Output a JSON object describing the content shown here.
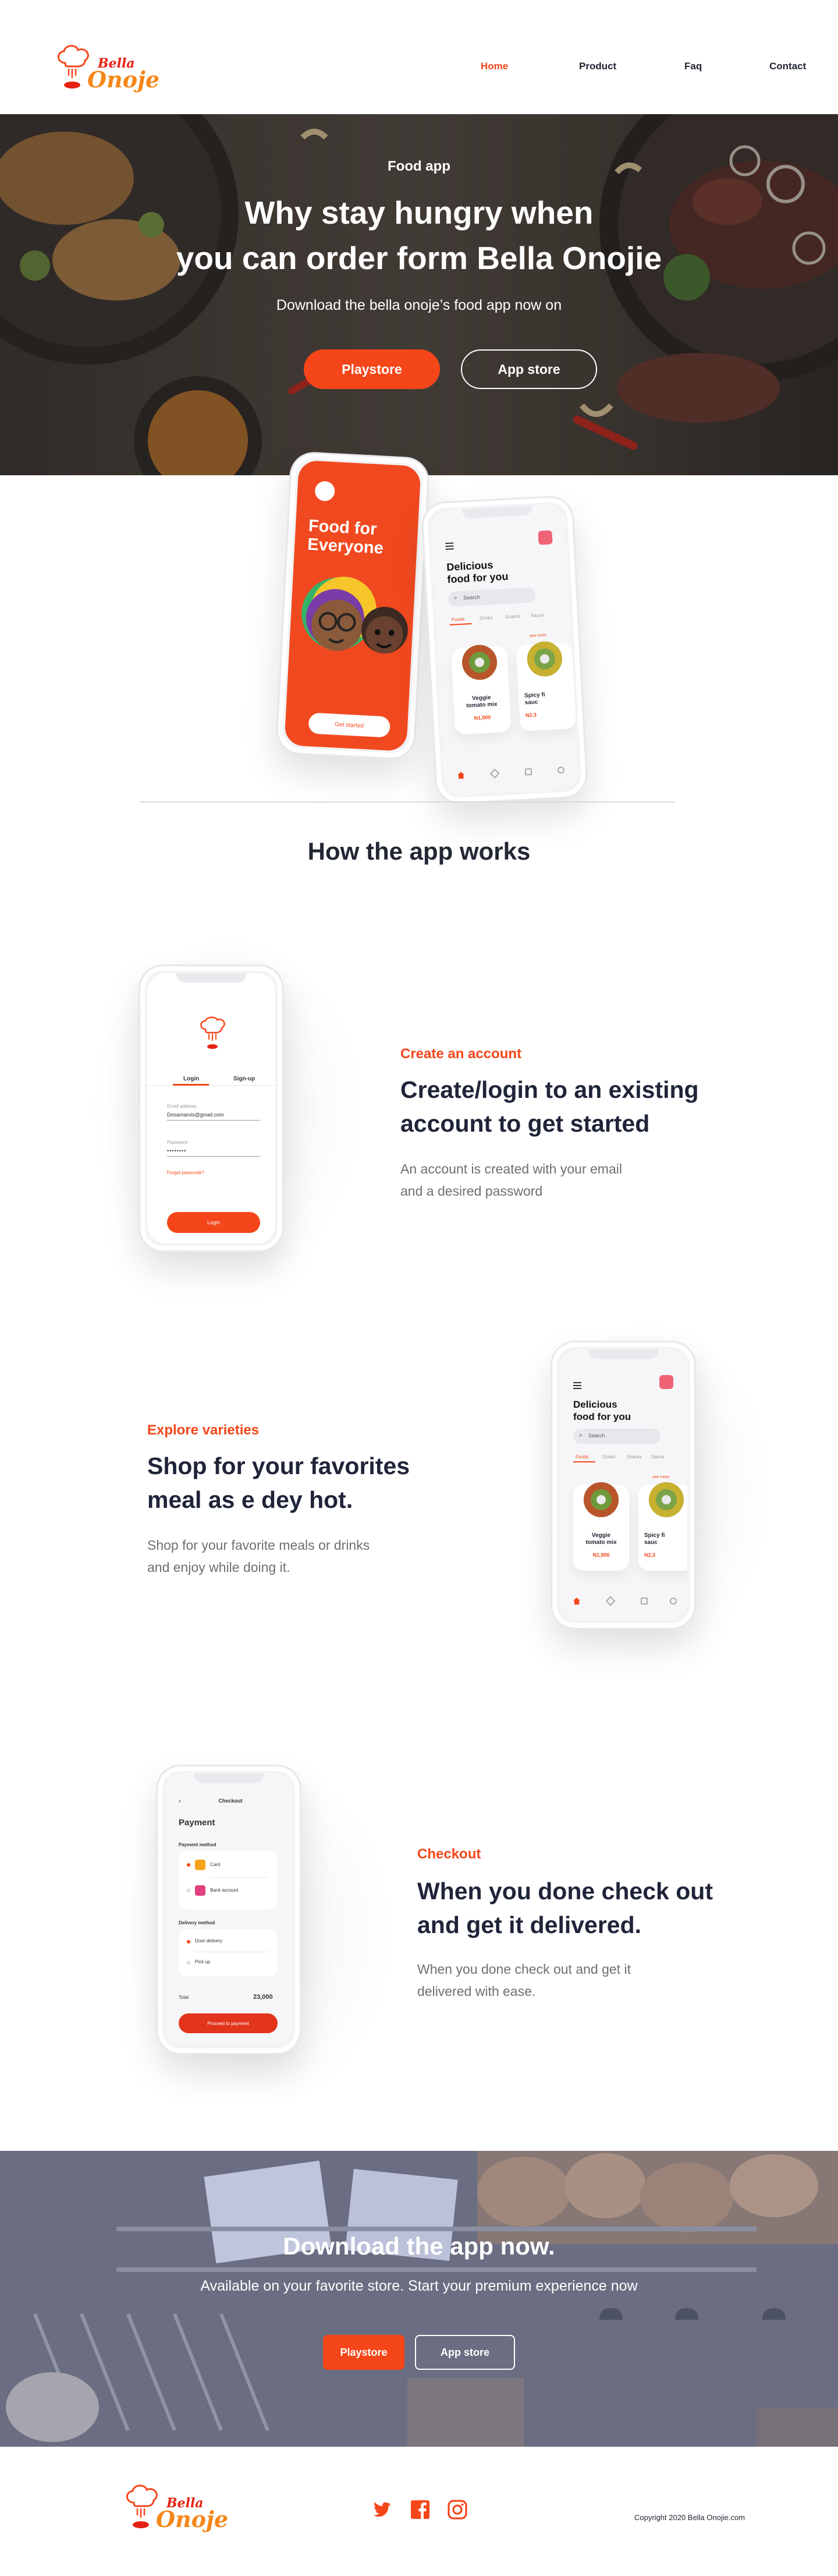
{
  "brand": {
    "name_top": "Bella",
    "name_bottom": "Onoje",
    "accent": "#f5461a",
    "dark": "#1f2439"
  },
  "nav": {
    "items": [
      "Home",
      "Product",
      "Faq",
      "Contact"
    ],
    "active": "Home"
  },
  "hero": {
    "kicker": "Food app",
    "title_line1": "Why stay hungry when",
    "title_line2": "you can order form Bella Onojie",
    "subtitle": "Download the bella onoje’s food app now on",
    "btn_primary": "Playstore",
    "btn_secondary": "App store"
  },
  "hero_phones": {
    "splash_title_line1": "Food for",
    "splash_title_line2": "Everyone",
    "splash_button": "Get started",
    "menu_title_line1": "Delicious",
    "menu_title_line2": "food for you",
    "search_placeholder": "Search",
    "tabs": [
      "Foods",
      "Drinks",
      "Snacks",
      "Sauce"
    ],
    "see_more": "see more",
    "card1_name_line1": "Veggie",
    "card1_name_line2": "tomato mix",
    "card1_price": "N1,900",
    "card2_name_line1": "Spicy fi",
    "card2_name_line2": "sauc",
    "card2_price": "N2,3"
  },
  "how": {
    "title": "How the app works"
  },
  "step1": {
    "kicker": "Create an account",
    "heading_line1": "Create/login to an existing",
    "heading_line2": "account to get started",
    "para_line1": "An account is created with your email",
    "para_line2": "and a desired password",
    "phone": {
      "tab_login": "Login",
      "tab_signup": "Sign-up",
      "email_label": "Email address",
      "email_value": "Dosamarvis@gmail.com",
      "password_label": "Password",
      "password_value": "••••••••",
      "forgot": "Forgot passcode?",
      "button": "Login"
    }
  },
  "step2": {
    "kicker": "Explore varieties",
    "heading_line1": "Shop for your favorites",
    "heading_line2": "meal as e dey hot.",
    "para_line1": "Shop for your favorite meals or drinks",
    "para_line2": "and enjoy while doing it."
  },
  "step3": {
    "kicker": "Checkout",
    "heading_line1": "When you done check out",
    "heading_line2": "and get it delivered.",
    "para_line1": "When you done check out and get it",
    "para_line2": "delivered with ease.",
    "phone": {
      "header": "Checkout",
      "title": "Payment",
      "payment_label": "Payment method",
      "pay_card": "Card",
      "pay_bank": "Bank account",
      "delivery_label": "Delivery method",
      "del_door": "Door delivery",
      "del_pick": "Pick up",
      "total_label": "Total",
      "total_value": "23,000",
      "button": "Proceed to payment"
    }
  },
  "cta": {
    "title": "Download the app now.",
    "subtitle": "Available on your favorite store. Start your premium experience now",
    "btn_primary": "Playstore",
    "btn_secondary": "App store"
  },
  "footer": {
    "copyright": "Copyright 2020 Bella Onojie.com"
  }
}
